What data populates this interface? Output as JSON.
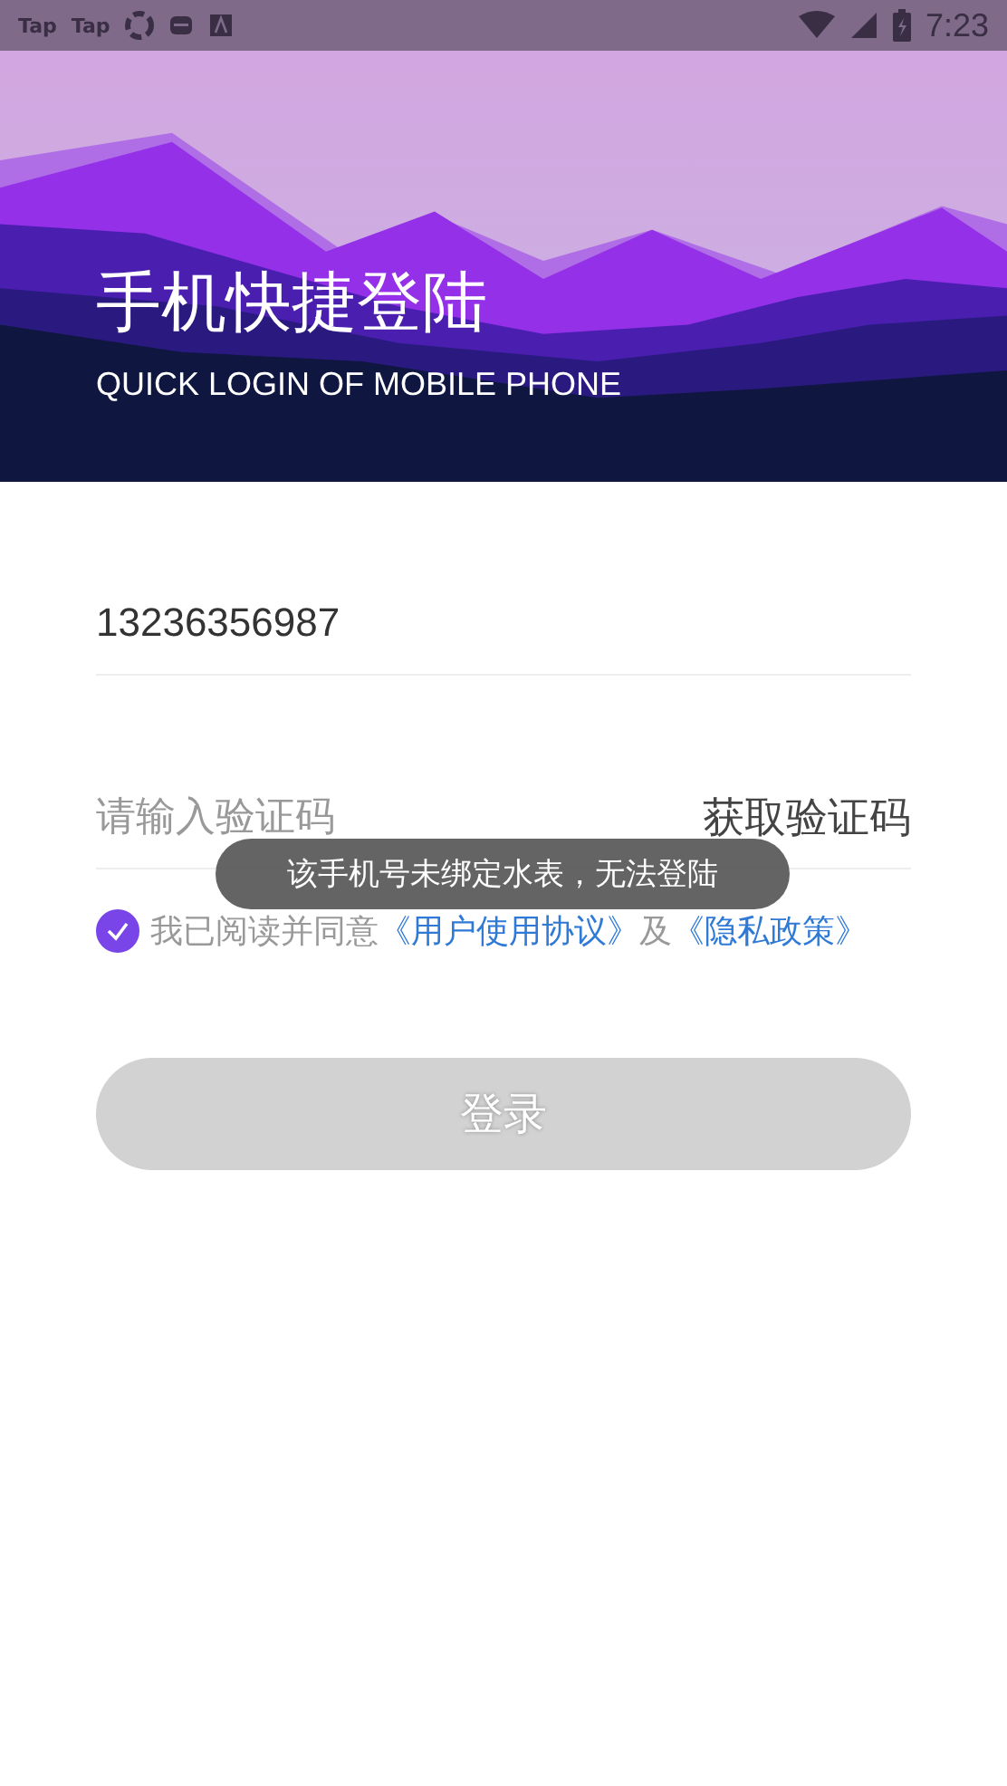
{
  "status_bar": {
    "notifications": [
      "Tap",
      "Tap"
    ],
    "time": "7:23"
  },
  "header": {
    "title": "手机快捷登陆",
    "subtitle": "QUICK LOGIN OF MOBILE PHONE"
  },
  "phone_field": {
    "value": "13236356987"
  },
  "code_field": {
    "placeholder": "请输入验证码",
    "action": "获取验证码"
  },
  "agreement": {
    "checked": true,
    "prefix": "我已阅读并同意",
    "link_1": "《用户使用协议》",
    "joiner": "及",
    "link_2": "《隐私政策》"
  },
  "login_button": {
    "label": "登录",
    "disabled": true
  },
  "toast": "该手机号未绑定水表，无法登陆"
}
